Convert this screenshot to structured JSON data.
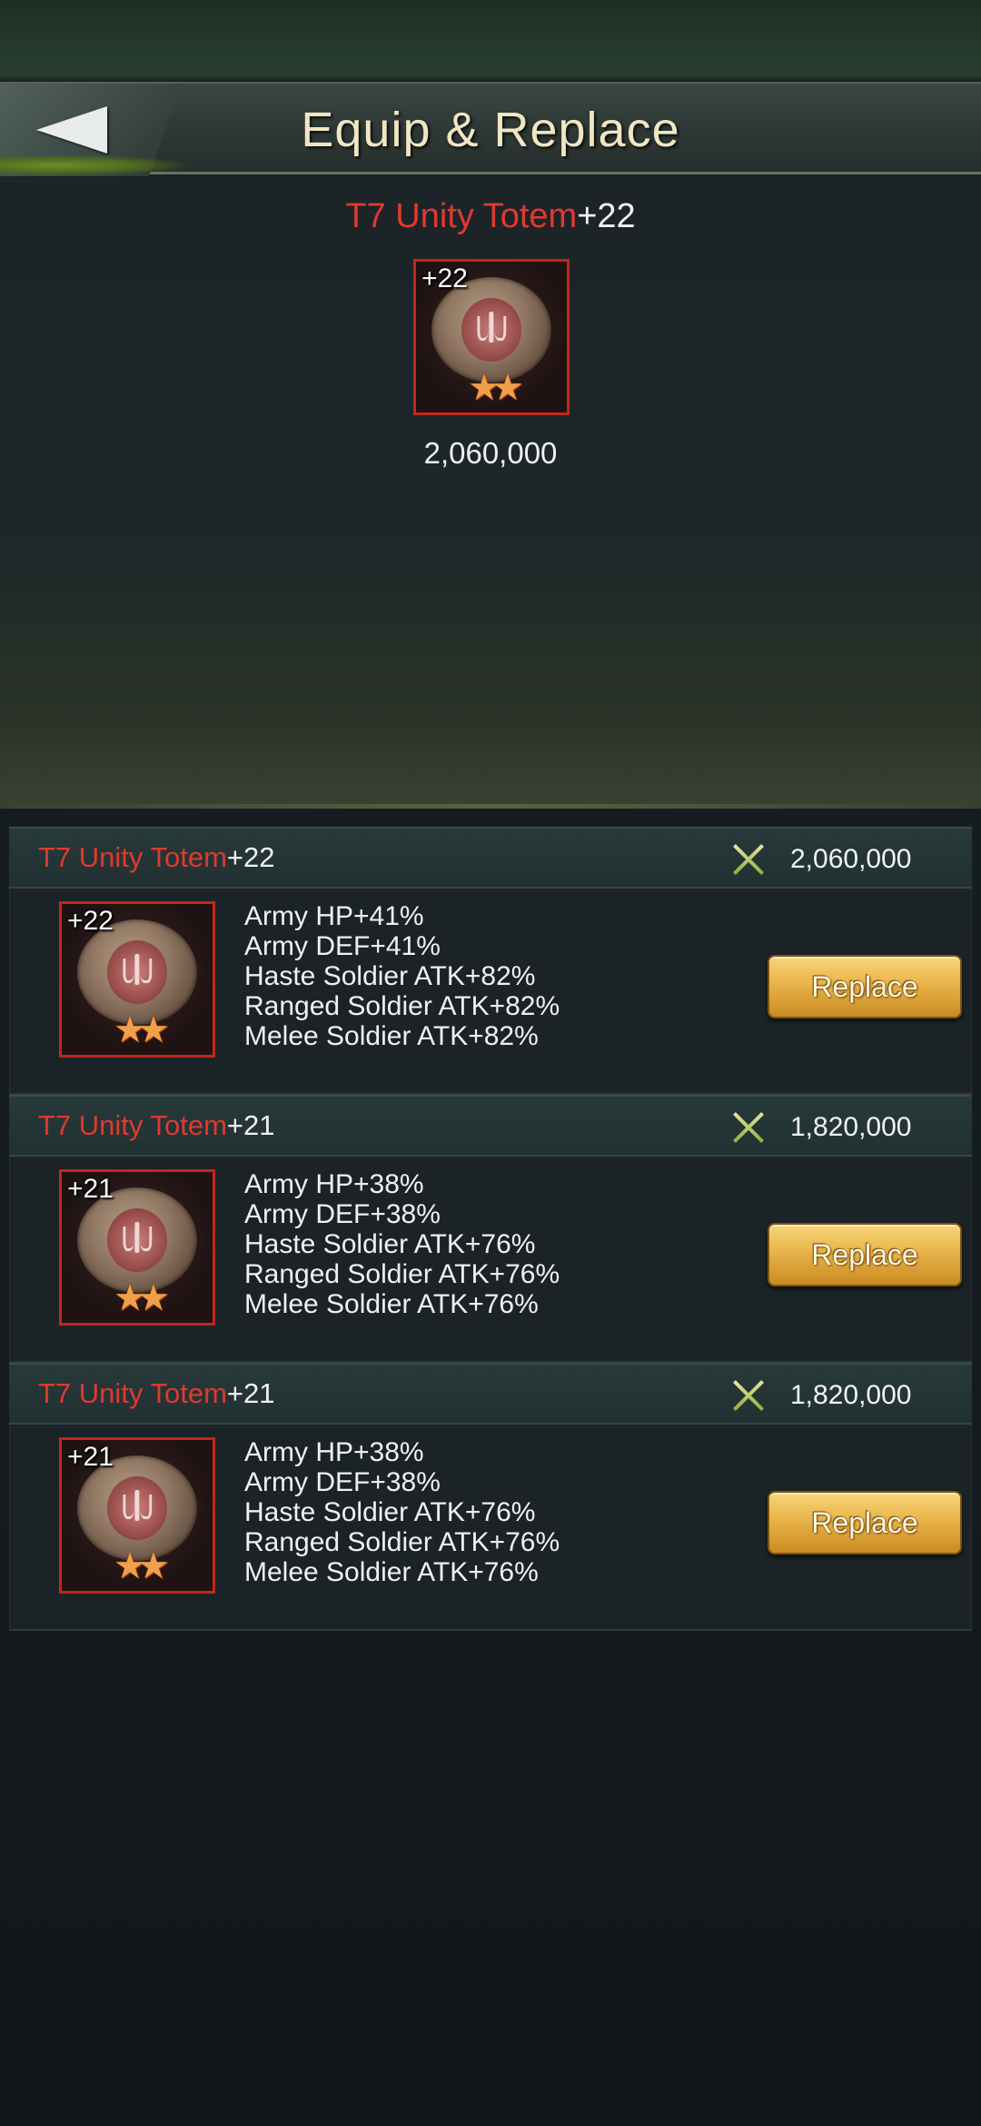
{
  "header": {
    "title": "Equip & Replace"
  },
  "equipped": {
    "name": "T7 Unity Totem",
    "level": "+22",
    "icon_level": "+22",
    "power": "2,060,000"
  },
  "items": [
    {
      "name": "T7 Unity Totem",
      "level": "+22",
      "icon_level": "+22",
      "power": "2,060,000",
      "stats": [
        "Army HP+41%",
        "Army DEF+41%",
        "Haste Soldier ATK+82%",
        "Ranged Soldier ATK+82%",
        "Melee Soldier ATK+82%"
      ],
      "button_label": "Replace"
    },
    {
      "name": "T7 Unity Totem",
      "level": "+21",
      "icon_level": "+21",
      "power": "1,820,000",
      "stats": [
        "Army HP+38%",
        "Army DEF+38%",
        "Haste Soldier ATK+76%",
        "Ranged Soldier ATK+76%",
        "Melee Soldier ATK+76%"
      ],
      "button_label": "Replace"
    },
    {
      "name": "T7 Unity Totem",
      "level": "+21",
      "icon_level": "+21",
      "power": "1,820,000",
      "stats": [
        "Army HP+38%",
        "Army DEF+38%",
        "Haste Soldier ATK+76%",
        "Ranged Soldier ATK+76%",
        "Melee Soldier ATK+76%"
      ],
      "button_label": "Replace"
    }
  ],
  "icons": {
    "back": "back-arrow-icon",
    "power": "crossed-swords-icon",
    "item": "unity-totem-icon"
  },
  "colors": {
    "item_name": "#e0392f",
    "button": "#e9b44a",
    "icon_border": "#c2261c"
  }
}
